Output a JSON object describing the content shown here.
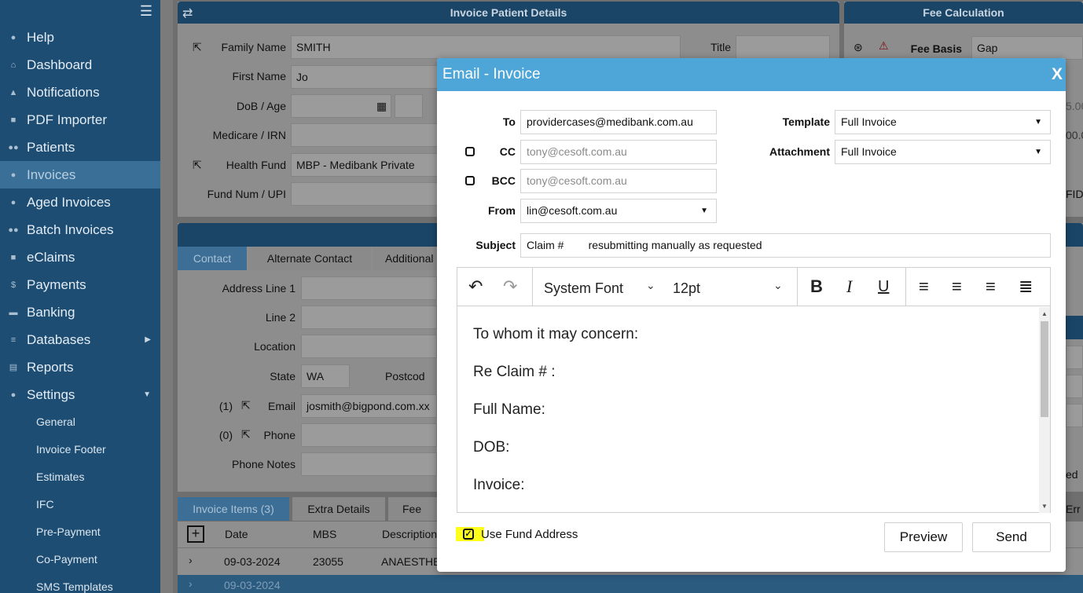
{
  "sidebar": {
    "items": [
      {
        "label": "Help",
        "icon": "help-icon"
      },
      {
        "label": "Dashboard",
        "icon": "home-icon"
      },
      {
        "label": "Notifications",
        "icon": "bell-icon"
      },
      {
        "label": "PDF Importer",
        "icon": "pdf-icon"
      },
      {
        "label": "Patients",
        "icon": "users-icon"
      },
      {
        "label": "Invoices",
        "icon": "user-icon"
      },
      {
        "label": "Aged Invoices",
        "icon": "aged-icon"
      },
      {
        "label": "Batch Invoices",
        "icon": "users-icon"
      },
      {
        "label": "eClaims",
        "icon": "file-icon"
      },
      {
        "label": "Payments",
        "icon": "dollar-icon"
      },
      {
        "label": "Banking",
        "icon": "bank-icon"
      },
      {
        "label": "Databases",
        "icon": "database-icon"
      },
      {
        "label": "Reports",
        "icon": "list-icon"
      },
      {
        "label": "Settings",
        "icon": "user-cog-icon"
      }
    ],
    "sub_items": [
      "General",
      "Invoice Footer",
      "Estimates",
      "IFC",
      "Pre-Payment",
      "Co-Payment",
      "SMS Templates"
    ]
  },
  "background": {
    "patient_panel_title": "Invoice Patient Details",
    "fee_panel_title": "Fee Calculation",
    "family_name_label": "Family Name",
    "family_name": "SMITH",
    "title_label": "Title",
    "first_name_label": "First Name",
    "first_name": "Jo",
    "dob_label": "DoB / Age",
    "medicare_label": "Medicare / IRN",
    "health_fund_label": "Health Fund",
    "health_fund": "MBP - Medibank Private",
    "fund_num_label": "Fund Num / UPI",
    "fee_basis_label": "Fee Basis",
    "fee_basis": "Gap",
    "fee_partial_1": "5.00",
    "fee_partial_2": "00.0",
    "fid_partial": "FID",
    "ed_partial": "ed",
    "err_partial": "Err",
    "contact_tabs": [
      "Contact",
      "Alternate Contact",
      "Additional"
    ],
    "address1_label": "Address Line 1",
    "line2_label": "Line 2",
    "location_label": "Location",
    "state_label": "State",
    "state": "WA",
    "postcode_label": "Postcod",
    "email_count": "(1)",
    "email_label": "Email",
    "email": "josmith@bigpond.com.xx",
    "phone_count": "(0)",
    "phone_label": "Phone",
    "phone_notes_label": "Phone Notes",
    "item_tabs": [
      "Invoice Items (3)",
      "Extra Details",
      "Fee Ca"
    ],
    "item_columns": [
      "Date",
      "MBS",
      "Description"
    ],
    "rows": [
      {
        "date": "09-03-2024",
        "mbs": "23055",
        "desc": "ANAESTHE"
      },
      {
        "date": "09-03-2024",
        "mbs": "",
        "desc": ""
      }
    ]
  },
  "modal": {
    "title": "Email - Invoice",
    "close": "X",
    "to_label": "To",
    "to_value": "providercases@medibank.com.au",
    "cc_label": "CC",
    "cc_placeholder": "tony@cesoft.com.au",
    "bcc_label": "BCC",
    "bcc_placeholder": "tony@cesoft.com.au",
    "from_label": "From",
    "from_value": "lin@cesoft.com.au",
    "template_label": "Template",
    "template_value": "Full Invoice",
    "attachment_label": "Attachment",
    "attachment_value": "Full Invoice",
    "subject_label": "Subject",
    "subject_value": "Claim #        resubmitting manually as requested",
    "font_family": "System Font",
    "font_size": "12pt",
    "body_lines": [
      "To whom it may concern:",
      "Re Claim # :",
      "Full Name:",
      "DOB:",
      "Invoice:"
    ],
    "use_fund_address_label": "Use Fund Address",
    "use_fund_address_checked": true,
    "preview_label": "Preview",
    "send_label": "Send"
  }
}
